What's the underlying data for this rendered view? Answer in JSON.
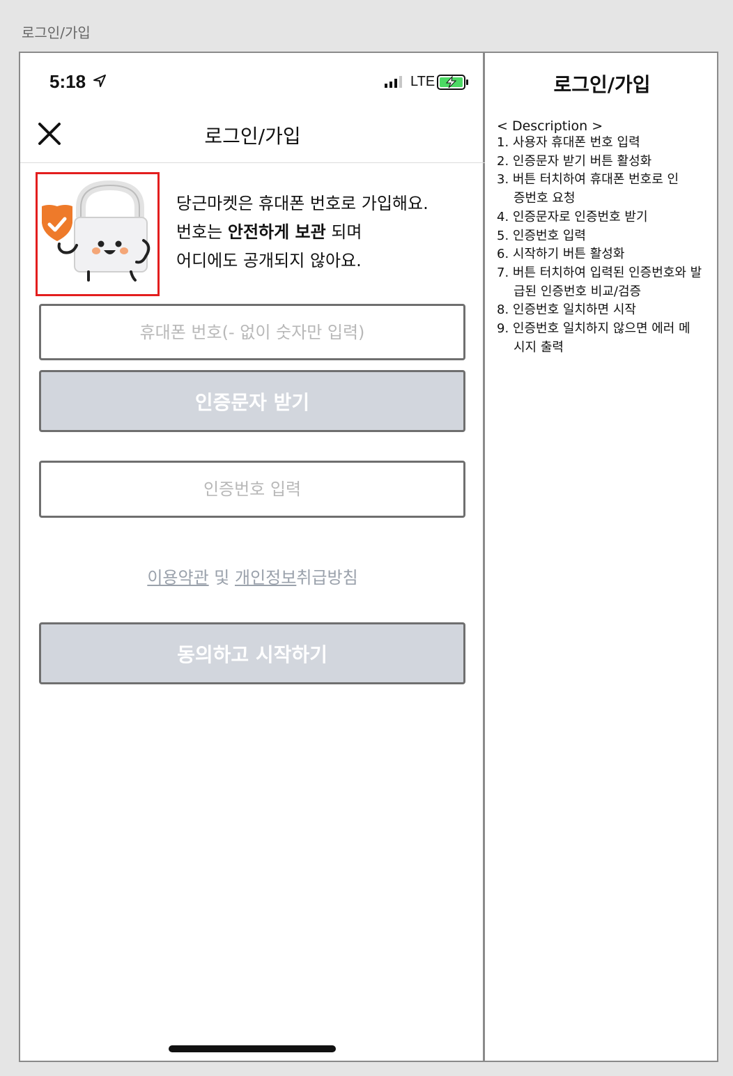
{
  "page_label": "로그인/가입",
  "status_bar": {
    "time": "5:18",
    "network": "LTE",
    "icons": [
      "location-arrow-icon",
      "signal-icon",
      "battery-charging-icon"
    ]
  },
  "header": {
    "title": "로그인/가입",
    "close_icon": "close-icon"
  },
  "intro": {
    "line1": "당근마켓은 휴대폰 번호로 가입해요.",
    "line2_prefix": "번호는 ",
    "line2_bold": "안전하게 보관",
    "line2_suffix": " 되며",
    "line3": "어디에도 공개되지 않아요."
  },
  "form": {
    "phone_placeholder": "휴대폰 번호(- 없이 숫자만 입력)",
    "sms_button": "인증문자 받기",
    "code_placeholder": "인증번호 입력",
    "terms_link": "이용약관",
    "terms_and": " 및 ",
    "privacy_link": "개인정보",
    "privacy_rest": "취급방침",
    "start_button": "동의하고 시작하기"
  },
  "colors": {
    "highlight_border": "#e31e1e",
    "disabled_button": "#d2d6dd",
    "shield": "#ee7a2a"
  },
  "description": {
    "title": "로그인/가입",
    "heading": "< Description >",
    "items": [
      "1. 사용자 휴대폰 번호 입력",
      "2. 인증문자 받기 버튼 활성화",
      "3. 버튼 터치하여 휴대폰 번호로 인증번호 요청",
      "4. 인증문자로 인증번호 받기",
      "5. 인증번호 입력",
      "6. 시작하기 버튼 활성화",
      "7. 버튼 터치하여 입력된 인증번호와 발급된 인증번호 비교/검증",
      "8. 인증번호 일치하면 시작",
      "9. 인증번호 일치하지 않으면 에러 메시지 출력"
    ]
  }
}
